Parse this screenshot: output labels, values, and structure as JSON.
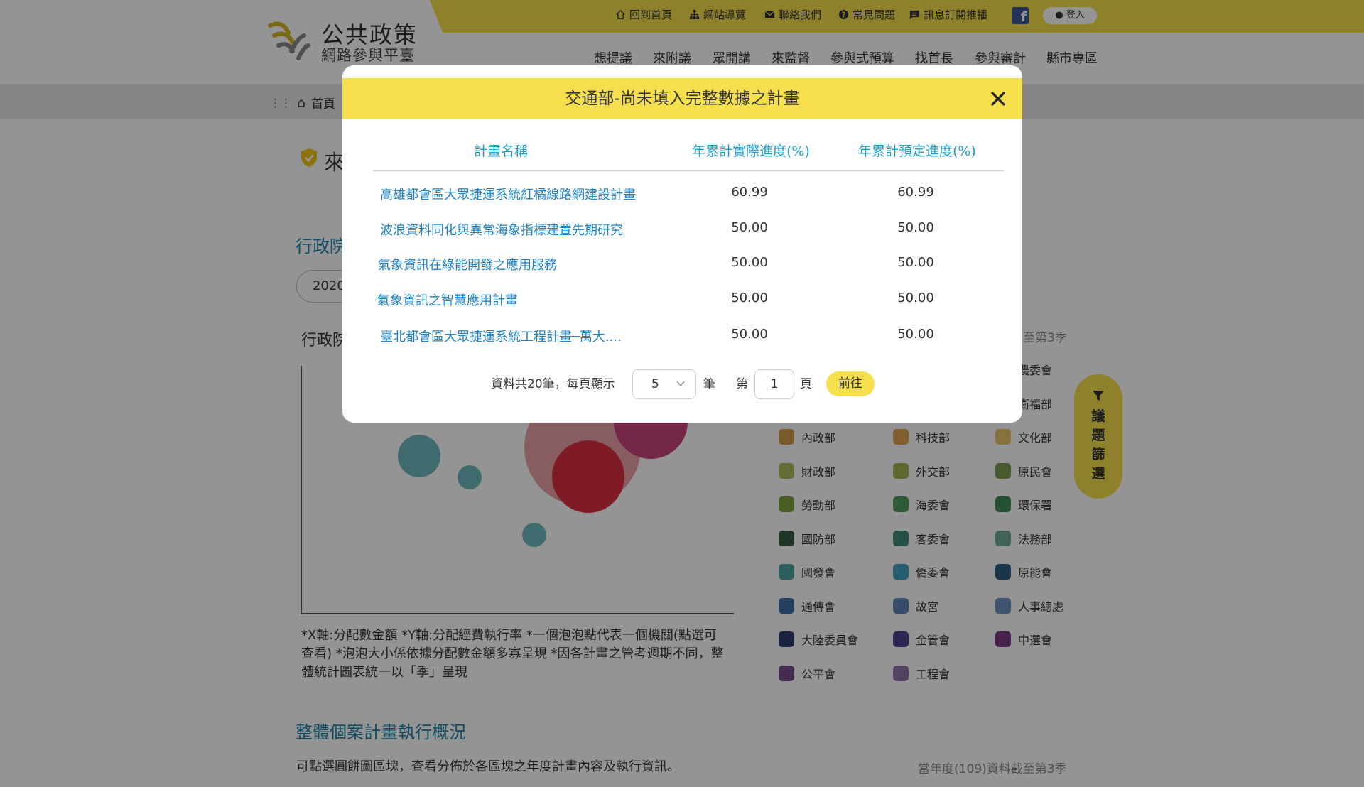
{
  "header": {
    "logo_title": "公共政策",
    "logo_subtitle": "網路參與平臺",
    "utility_links": [
      {
        "label": "回到首頁",
        "icon": "home-return-icon"
      },
      {
        "label": "網站導覽",
        "icon": "sitemap-icon"
      },
      {
        "label": "聯絡我們",
        "icon": "mail-icon"
      },
      {
        "label": "常見問題",
        "icon": "help-icon"
      },
      {
        "label": "訊息訂閱推播",
        "icon": "chat-icon"
      }
    ],
    "facebook_icon": "facebook-icon",
    "login_label": "登入",
    "nav": [
      "想提議",
      "來附議",
      "眾開講",
      "來監督",
      "參與式預算",
      "找首長",
      "參與審計",
      "縣市專區"
    ]
  },
  "breadcrumb": {
    "home_label": "首頁",
    "separator": "•"
  },
  "page": {
    "title": "來",
    "section_admin": "行政院",
    "year_pill": "2020",
    "chart_title": "行政院",
    "chart_note": "*X軸:分配數金額  *Y軸:分配經費執行率  *一個泡泡點代表一個機關(點選可查看)  *泡泡大小係依據分配數金額多寡呈現  *因各計畫之管考週期不同，整體統計圖表統一以「季」呈現",
    "season_note_1": "至第3季",
    "section_overall": "整體個案計畫執行概況",
    "pie_desc": "可點選圓餅圖區塊，查看分佈於各區塊之年度計畫內容及執行資訊。",
    "season_note_2": "當年度(109)資料截至第3季",
    "filter_label": "議題篩選"
  },
  "legend": [
    {
      "label": "農委會",
      "color": "#c9a56a"
    },
    {
      "label": "衛福部",
      "color": "#c9a56a"
    },
    {
      "label": "內政部",
      "color": "#d39a4a"
    },
    {
      "label": "科技部",
      "color": "#e0a04f"
    },
    {
      "label": "文化部",
      "color": "#e8c56a"
    },
    {
      "label": "財政部",
      "color": "#a9bd58"
    },
    {
      "label": "外交部",
      "color": "#9fb44c"
    },
    {
      "label": "原民會",
      "color": "#7f9b4e"
    },
    {
      "label": "勞動部",
      "color": "#7ea23e"
    },
    {
      "label": "海委會",
      "color": "#4d9e5c"
    },
    {
      "label": "環保署",
      "color": "#3d8a55"
    },
    {
      "label": "國防部",
      "color": "#365e48"
    },
    {
      "label": "客委會",
      "color": "#3f8a78"
    },
    {
      "label": "法務部",
      "color": "#6fa99a"
    },
    {
      "label": "國發會",
      "color": "#4ea3a3"
    },
    {
      "label": "僑委會",
      "color": "#3ea0c2"
    },
    {
      "label": "原能會",
      "color": "#2f5d80"
    },
    {
      "label": "通傳會",
      "color": "#3d6fa6"
    },
    {
      "label": "故宮",
      "color": "#5c86b8"
    },
    {
      "label": "人事總處",
      "color": "#6b8fbf"
    },
    {
      "label": "大陸委員會",
      "color": "#2e3f73"
    },
    {
      "label": "金管會",
      "color": "#4f3f8c"
    },
    {
      "label": "中選會",
      "color": "#7a3a82"
    },
    {
      "label": "公平會",
      "color": "#744a8c"
    },
    {
      "label": "工程會",
      "color": "#8b76a8"
    }
  ],
  "bubbles": [
    {
      "color": "#6db9bf"
    },
    {
      "color": "#6db9bf"
    },
    {
      "color": "#6db9bf"
    },
    {
      "color": "#e8a0a8"
    },
    {
      "color": "#c9447a"
    },
    {
      "color": "#d92f3f"
    }
  ],
  "modal": {
    "title": "交通部-尚未填入完整數據之計畫",
    "close_icon": "close-icon",
    "columns": [
      "計畫名稱",
      "年累計實際進度(%)",
      "年累計預定進度(%)"
    ],
    "rows": [
      {
        "name": "高雄都會區大眾捷運系統紅橘線路網建設計畫",
        "actual": "60.99",
        "planned": "60.99"
      },
      {
        "name": "波浪資料同化與異常海象指標建置先期研究",
        "actual": "50.00",
        "planned": "50.00"
      },
      {
        "name": "氣象資訊在綠能開發之應用服務",
        "actual": "50.00",
        "planned": "50.00"
      },
      {
        "name": "氣象資訊之智慧應用計畫",
        "actual": "50.00",
        "planned": "50.00"
      },
      {
        "name": "臺北都會區大眾捷運系統工程計畫─萬大....",
        "actual": "50.00",
        "planned": "50.00"
      }
    ],
    "pager": {
      "total_text": "資料共20筆，每頁顯示",
      "per_page": "5",
      "unit_text": "筆",
      "page_prefix": "第",
      "page_value": "1",
      "page_suffix": "頁",
      "go_label": "前往"
    }
  }
}
